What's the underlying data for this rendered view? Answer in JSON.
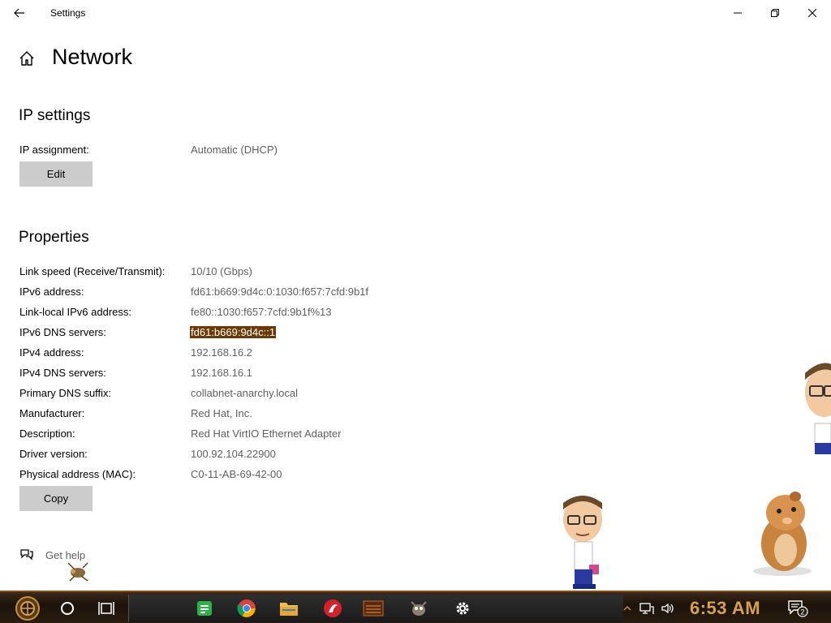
{
  "window": {
    "title": "Settings"
  },
  "page": {
    "title": "Network"
  },
  "ip_settings": {
    "title": "IP settings",
    "assignment_label": "IP assignment:",
    "assignment_value": "Automatic (DHCP)",
    "edit_label": "Edit"
  },
  "properties": {
    "title": "Properties",
    "rows": [
      {
        "label": "Link speed (Receive/Transmit):",
        "value": "10/10 (Gbps)"
      },
      {
        "label": "IPv6 address:",
        "value": "fd61:b669:9d4c:0:1030:f657:7cfd:9b1f"
      },
      {
        "label": "Link-local IPv6 address:",
        "value": "fe80::1030:f657:7cfd:9b1f%13"
      },
      {
        "label": "IPv6 DNS servers:",
        "value": "fd61:b669:9d4c::1"
      },
      {
        "label": "IPv4 address:",
        "value": "192.168.16.2"
      },
      {
        "label": "IPv4 DNS servers:",
        "value": "192.168.16.1"
      },
      {
        "label": "Primary DNS suffix:",
        "value": "collabnet-anarchy.local"
      },
      {
        "label": "Manufacturer:",
        "value": "Red Hat, Inc."
      },
      {
        "label": "Description:",
        "value": "Red Hat VirtIO Ethernet Adapter"
      },
      {
        "label": "Driver version:",
        "value": "100.92.104.22900"
      },
      {
        "label": "Physical address (MAC):",
        "value": "C0-11-AB-69-42-00"
      }
    ],
    "copy_label": "Copy"
  },
  "help": {
    "label": "Get help"
  },
  "taskbar": {
    "clock": "6:53 AM",
    "notification_count": "2",
    "apps": [
      "spreadsheet-icon",
      "chrome-icon",
      "file-explorer-icon",
      "red-app-icon",
      "calendar-app-icon",
      "gimp-icon",
      "settings-gear-icon"
    ]
  },
  "colors": {
    "selection_bg": "#6b3a06",
    "button_bg": "#cccccc",
    "clock": "#d8a24a",
    "taskbar_border": "#8a4a14"
  }
}
